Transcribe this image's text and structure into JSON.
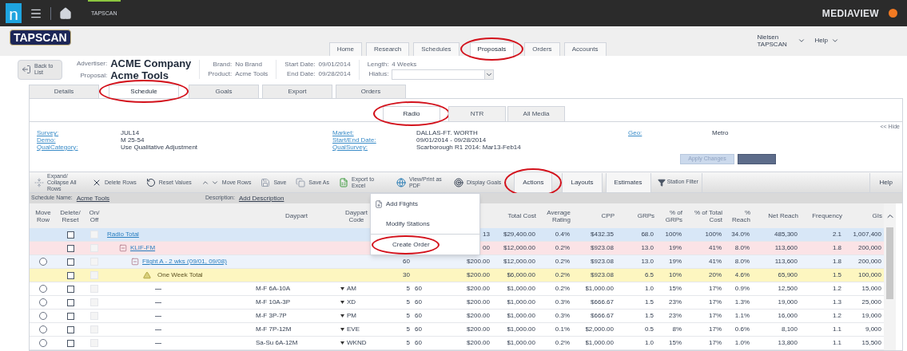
{
  "top_bar": {
    "logo": "n",
    "app_tab": "TAPSCAN",
    "brand": "MEDIAVIEW"
  },
  "header": {
    "logo": "TAPSCAN",
    "user": "Nielsen TAPSCAN",
    "help": "Help"
  },
  "nav_tabs": [
    {
      "label": "Home",
      "selected": false,
      "circled": false
    },
    {
      "label": "Research",
      "selected": false,
      "circled": false
    },
    {
      "label": "Schedules",
      "selected": false,
      "circled": false
    },
    {
      "label": "Proposals",
      "selected": true,
      "circled": true
    },
    {
      "label": "Orders",
      "selected": false,
      "circled": false
    },
    {
      "label": "Accounts",
      "selected": false,
      "circled": false
    }
  ],
  "proposal": {
    "back_button": "Back to List",
    "groups": [
      [
        {
          "label": "Advertiser:",
          "value": "ACME Company",
          "kind": "big"
        },
        {
          "label": "Proposal:",
          "value": "Acme Tools",
          "kind": "big"
        }
      ],
      [
        {
          "label": "Brand:",
          "value": "No Brand",
          "kind": "plain"
        },
        {
          "label": "Product:",
          "value": "Acme Tools",
          "kind": "plain"
        }
      ],
      [
        {
          "label": "Start Date:",
          "value": "09/01/2014",
          "kind": "plain"
        },
        {
          "label": "End Date:",
          "value": "09/28/2014",
          "kind": "plain"
        }
      ],
      [
        {
          "label": "Length:",
          "value": "4 Weeks",
          "kind": "plain"
        },
        {
          "label": "Hiatus:",
          "kind": "select"
        }
      ]
    ]
  },
  "sub_tabs": [
    {
      "label": "Details",
      "selected": false,
      "circled": false
    },
    {
      "label": "Schedule",
      "selected": true,
      "circled": true
    },
    {
      "label": "Goals",
      "selected": false,
      "circled": false
    },
    {
      "label": "Export",
      "selected": false,
      "circled": false
    },
    {
      "label": "Orders",
      "selected": false,
      "circled": false
    }
  ],
  "media_tabs": [
    {
      "label": "Radio",
      "selected": true,
      "circled": true
    },
    {
      "label": "NTR",
      "selected": false,
      "circled": false
    },
    {
      "label": "All Media",
      "selected": false,
      "circled": false
    }
  ],
  "info": {
    "hide": "<< Hide",
    "apply_button": "Apply Changes",
    "columns": [
      [
        {
          "label": "Survey:",
          "value": "JUL14"
        },
        {
          "label": "Demo:",
          "value": "M 25-54"
        },
        {
          "label": "QualCategory:",
          "value": "Use Qualitative Adjustment"
        }
      ],
      [
        {
          "label": "Market:",
          "value": "DALLAS-FT. WORTH"
        },
        {
          "label": "Start/End Date:",
          "value": "09/01/2014 - 09/28/2014"
        },
        {
          "label": "QualSurvey:",
          "value": "Scarborough R1 2014: Mar13-Feb14"
        }
      ],
      [
        {
          "label": "Geo:",
          "value": "Metro"
        }
      ]
    ]
  },
  "toolbar": {
    "help": "Help",
    "items": [
      {
        "label": "Expand/ Collapse All Rows",
        "kind": "expand",
        "circled": false
      },
      {
        "label": "Delete Rows",
        "kind": "delete",
        "circled": false
      },
      {
        "label": "Reset Values",
        "kind": "reset",
        "circled": false
      },
      {
        "label": "Move Rows",
        "kind": "move",
        "circled": false
      },
      {
        "label": "Save",
        "kind": "save",
        "circled": false
      },
      {
        "label": "Save As",
        "kind": "saveas",
        "circled": false
      },
      {
        "label": "Export to Excel",
        "kind": "excel",
        "circled": false
      },
      {
        "label": "View/Print as PDF",
        "kind": "pdf",
        "circled": false
      },
      {
        "label": "Display Goals",
        "kind": "goals",
        "circled": false
      },
      {
        "label": "Actions",
        "kind": "menu",
        "circled": true
      },
      {
        "label": "Layouts",
        "kind": "menu",
        "circled": false
      },
      {
        "label": "Estimates",
        "kind": "menu",
        "circled": false
      },
      {
        "label": "Station Filter",
        "kind": "filter",
        "circled": false
      }
    ]
  },
  "schedule_bar": {
    "name_label": "Schedule Name:",
    "name": "Acme Tools",
    "description_label": "Description:",
    "description": "Add Description"
  },
  "actions_menu": [
    {
      "label": "Add Flights",
      "kind": "add",
      "divider_before": false,
      "circled": false
    },
    {
      "label": "Modify Stations",
      "kind": "plain",
      "divider_before": false,
      "circled": false
    },
    {
      "label": "Create Order",
      "kind": "plain",
      "divider_before": true,
      "circled": true
    }
  ],
  "table": {
    "headers": {
      "move_row": "Move Row",
      "delete_reset": "Delete/ Reset",
      "on_off": "On/ Off",
      "daypart": "Daypart",
      "daypart_code": "Daypart Code",
      "total_cost": "Total Cost",
      "average_rating": "Average Rating",
      "cpp": "CPP",
      "grps": "GRPs",
      "pct_grps": "% of GRPs",
      "pct_total_cost": "% of Total Cost",
      "pct_reach": "% Reach",
      "net_reach": "Net Reach",
      "frequency": "Frequency",
      "gis": "GIs"
    },
    "rows": [
      {
        "kind": "total",
        "name": "Radio Total",
        "movable": false,
        "checked": false,
        "cells": {
          "column_9": "13",
          "total_cost": "$29,400.00",
          "average_rating": "0.4%",
          "cpp": "$432.35",
          "grps": "68.0",
          "pct_grps": "100%",
          "pct_total_cost": "100%",
          "pct_reach": "34.0%",
          "net_reach": "485,300",
          "frequency": "2.1",
          "gis": "1,007,400"
        },
        "children": [
          {
            "kind": "station",
            "name": "KLIF-FM",
            "expanded": true,
            "movable": false,
            "checked": false,
            "cells": {
              "column_9": "00",
              "total_cost": "$12,000.00",
              "average_rating": "0.2%",
              "cpp": "$923.08",
              "grps": "13.0",
              "pct_grps": "19%",
              "pct_total_cost": "41%",
              "pct_reach": "8.0%",
              "net_reach": "113,600",
              "frequency": "1.8",
              "gis": "200,000"
            },
            "children": [
              {
                "kind": "flight",
                "name": "Flight A - 2 wks (09/01, 09/08)",
                "expanded": true,
                "movable": true,
                "selected": false,
                "checked": false,
                "cells": {
                  "column_7": "60",
                  "column_9": "$200.00",
                  "total_cost": "$12,000.00",
                  "average_rating": "0.2%",
                  "cpp": "$923.08",
                  "grps": "13.0",
                  "pct_grps": "19%",
                  "pct_total_cost": "41%",
                  "pct_reach": "8.0%",
                  "net_reach": "113,600",
                  "frequency": "1.8",
                  "gis": "200,000"
                },
                "children": [
                  {
                    "kind": "week",
                    "name": "One Week Total",
                    "movable": false,
                    "checked": false,
                    "cells": {
                      "column_7": "30",
                      "column_9": "$200.00",
                      "total_cost": "$6,000.00",
                      "average_rating": "0.2%",
                      "cpp": "$923.08",
                      "grps": "6.5",
                      "pct_grps": "10%",
                      "pct_total_cost": "20%",
                      "pct_reach": "4.6%",
                      "net_reach": "65,900",
                      "frequency": "1.5",
                      "gis": "100,000"
                    },
                    "children": [
                      {
                        "kind": "line",
                        "daypart": "M-F 6A-10A",
                        "code": "AM",
                        "movable": true,
                        "selected": false,
                        "checked": false,
                        "cells": {
                          "column_7": "5",
                          "column_8": "60",
                          "column_9": "$200.00",
                          "total_cost": "$1,000.00",
                          "average_rating": "0.2%",
                          "cpp": "$1,000.00",
                          "grps": "1.0",
                          "pct_grps": "15%",
                          "pct_total_cost": "17%",
                          "pct_reach": "0.9%",
                          "net_reach": "12,500",
                          "frequency": "1.2",
                          "gis": "15,000"
                        }
                      },
                      {
                        "kind": "line",
                        "daypart": "M-F 10A-3P",
                        "code": "XD",
                        "movable": true,
                        "selected": false,
                        "checked": false,
                        "cells": {
                          "column_7": "5",
                          "column_8": "60",
                          "column_9": "$200.00",
                          "total_cost": "$1,000.00",
                          "average_rating": "0.3%",
                          "cpp": "$666.67",
                          "grps": "1.5",
                          "pct_grps": "23%",
                          "pct_total_cost": "17%",
                          "pct_reach": "1.3%",
                          "net_reach": "19,000",
                          "frequency": "1.3",
                          "gis": "25,000"
                        }
                      },
                      {
                        "kind": "line",
                        "daypart": "M-F 3P-7P",
                        "code": "PM",
                        "movable": true,
                        "selected": false,
                        "checked": false,
                        "cells": {
                          "column_7": "5",
                          "column_8": "60",
                          "column_9": "$200.00",
                          "total_cost": "$1,000.00",
                          "average_rating": "0.3%",
                          "cpp": "$666.67",
                          "grps": "1.5",
                          "pct_grps": "23%",
                          "pct_total_cost": "17%",
                          "pct_reach": "1.1%",
                          "net_reach": "16,000",
                          "frequency": "1.2",
                          "gis": "19,000"
                        }
                      },
                      {
                        "kind": "line",
                        "daypart": "M-F 7P-12M",
                        "code": "EVE",
                        "movable": true,
                        "selected": false,
                        "checked": false,
                        "cells": {
                          "column_7": "5",
                          "column_8": "60",
                          "column_9": "$200.00",
                          "total_cost": "$1,000.00",
                          "average_rating": "0.1%",
                          "cpp": "$2,000.00",
                          "grps": "0.5",
                          "pct_grps": "8%",
                          "pct_total_cost": "17%",
                          "pct_reach": "0.6%",
                          "net_reach": "8,100",
                          "frequency": "1.1",
                          "gis": "9,000"
                        }
                      },
                      {
                        "kind": "line",
                        "daypart": "Sa-Su 6A-12M",
                        "code": "WKND",
                        "movable": true,
                        "selected": false,
                        "checked": false,
                        "cells": {
                          "column_7": "5",
                          "column_8": "60",
                          "column_9": "$200.00",
                          "total_cost": "$1,000.00",
                          "average_rating": "0.2%",
                          "cpp": "$1,000.00",
                          "grps": "1.0",
                          "pct_grps": "15%",
                          "pct_total_cost": "17%",
                          "pct_reach": "1.0%",
                          "net_reach": "13,800",
                          "frequency": "1.1",
                          "gis": "15,500"
                        }
                      }
                    ]
                  }
                ]
              }
            ]
          }
        ]
      }
    ]
  }
}
